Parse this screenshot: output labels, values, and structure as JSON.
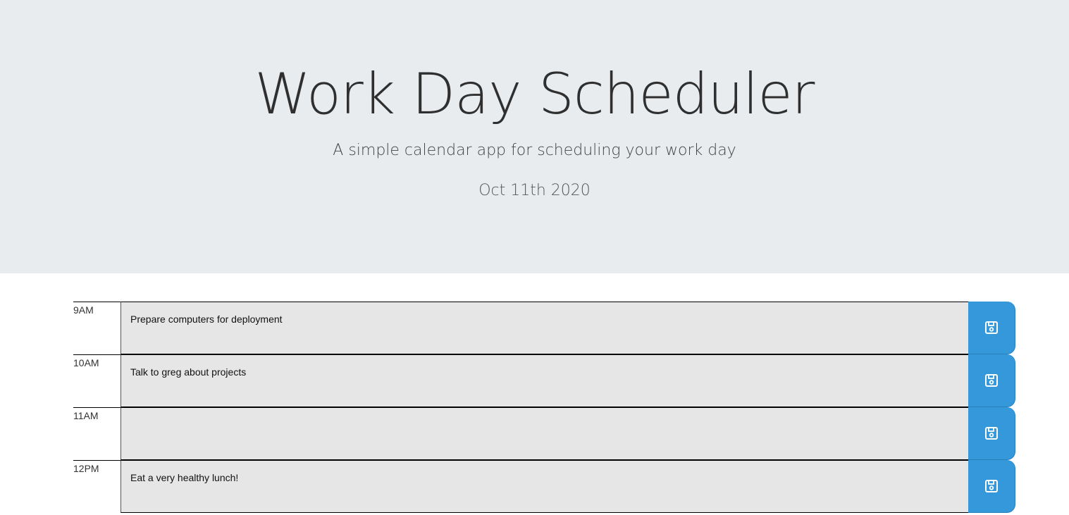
{
  "header": {
    "title": "Work Day Scheduler",
    "subtitle": "A simple calendar app for scheduling your work day",
    "current_date": "Oct 11th 2020"
  },
  "schedule": [
    {
      "hour": "9AM",
      "description": "Prepare computers for deployment"
    },
    {
      "hour": "10AM",
      "description": "Talk to greg about projects"
    },
    {
      "hour": "11AM",
      "description": ""
    },
    {
      "hour": "12PM",
      "description": "Eat a very healthy lunch!"
    }
  ],
  "icons": {
    "save": "floppy-disk-icon"
  },
  "colors": {
    "header_background": "#e9ecef",
    "textarea_background": "#e6e6e6",
    "save_button": "#3498db"
  }
}
